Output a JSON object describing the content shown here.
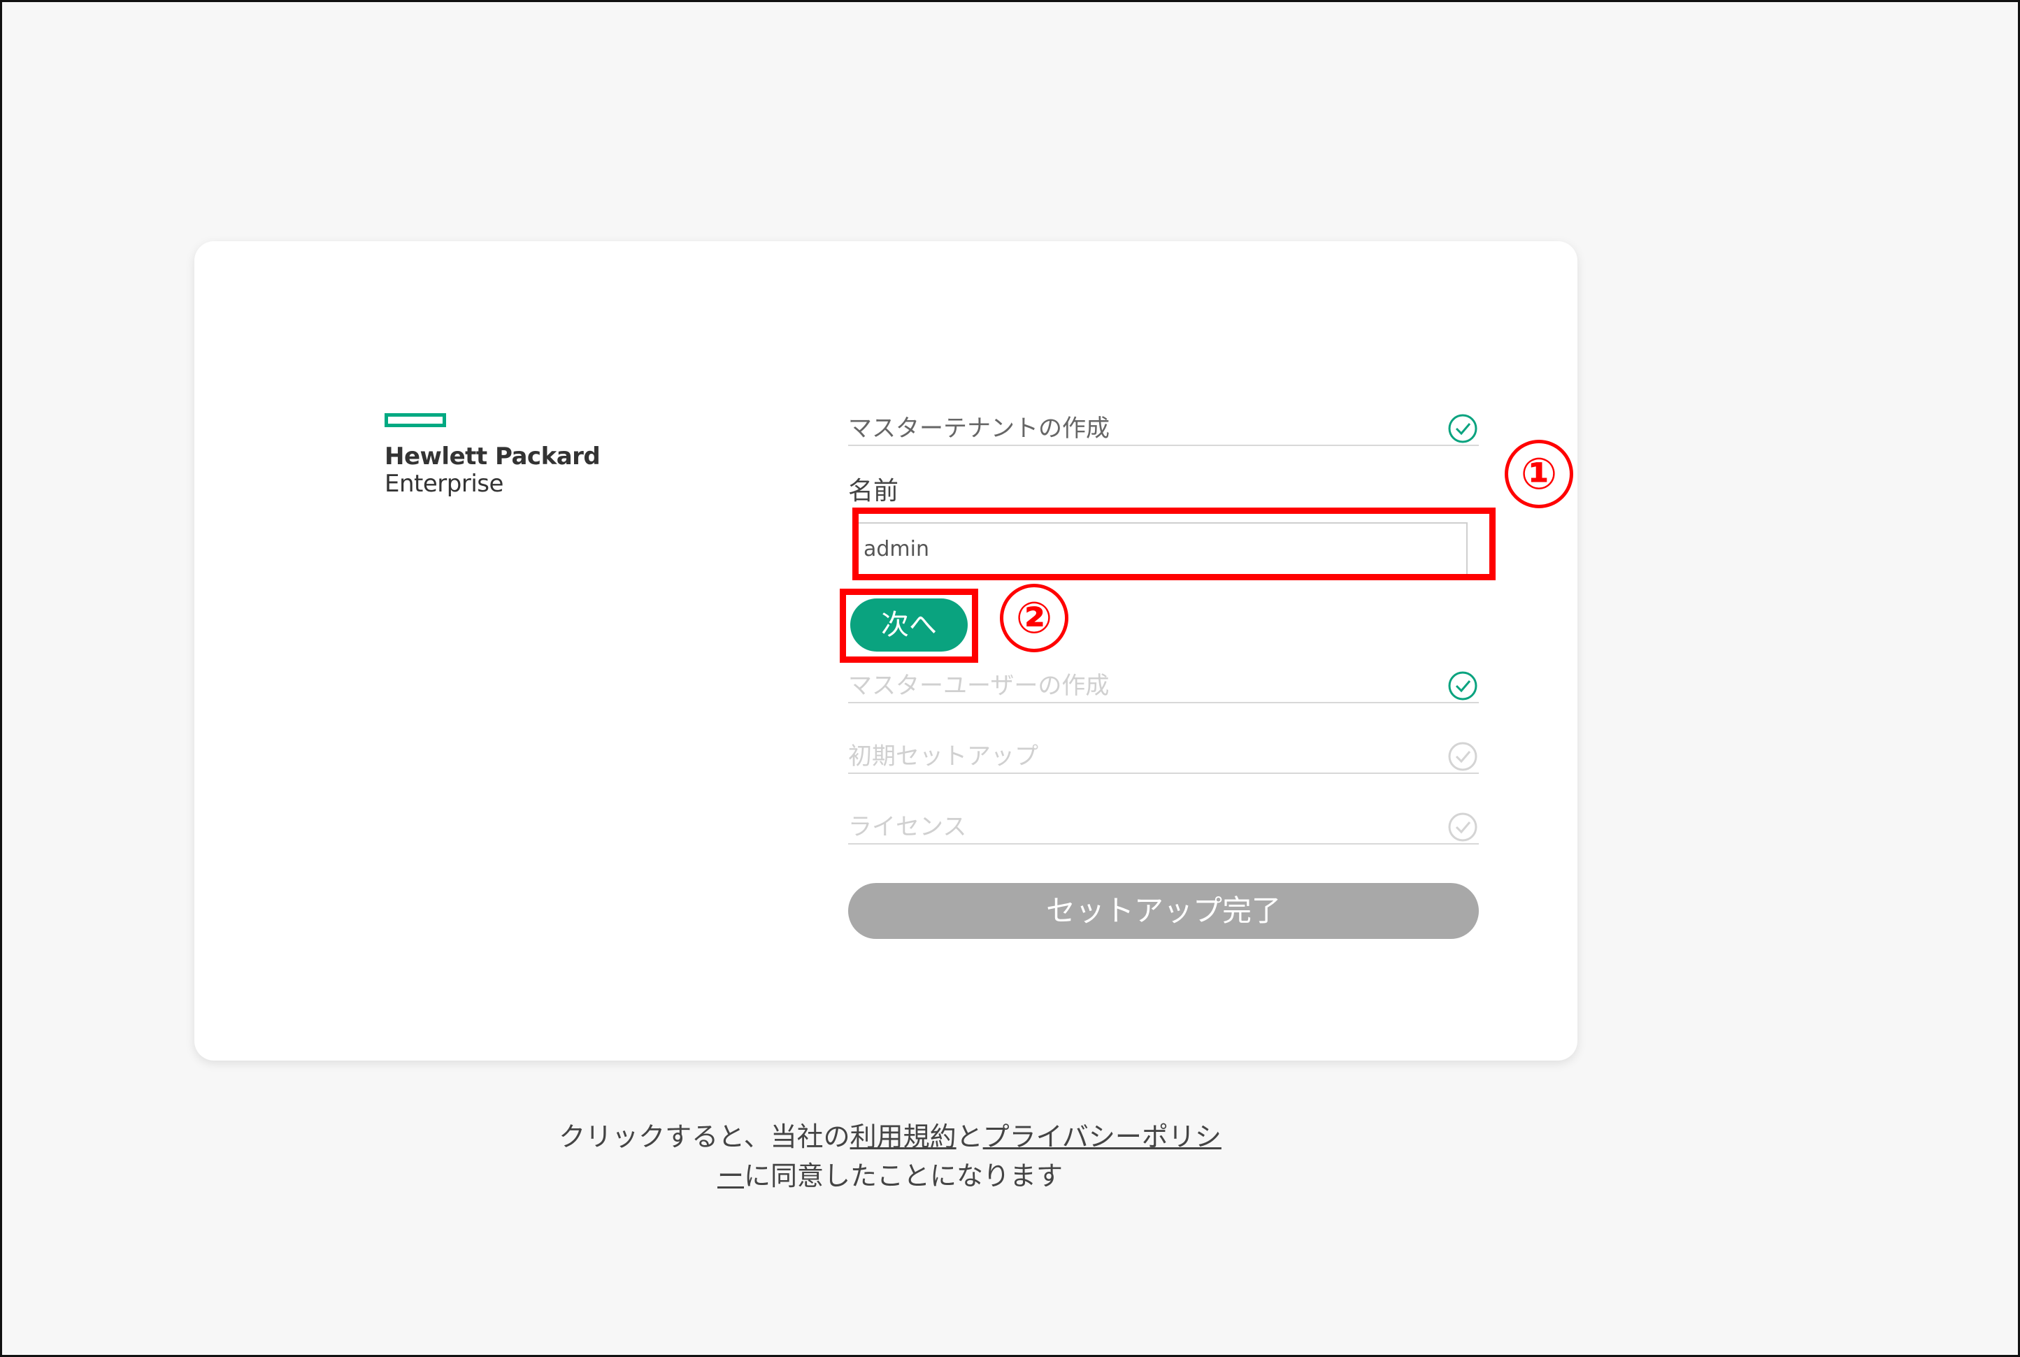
{
  "logo": {
    "line1": "Hewlett Packard",
    "line2": "Enterprise"
  },
  "steps": [
    {
      "label": "マスターテナントの作成",
      "state": "active",
      "icon": "check-circle-icon"
    },
    {
      "label": "マスターユーザーの作成",
      "state": "done",
      "icon": "check-circle-icon"
    },
    {
      "label": "初期セットアップ",
      "state": "pending",
      "icon": "check-circle-icon"
    },
    {
      "label": "ライセンス",
      "state": "pending",
      "icon": "check-circle-icon"
    }
  ],
  "form": {
    "name_label": "名前",
    "name_value": "admin",
    "next_label": "次へ"
  },
  "finish_label": "セットアップ完了",
  "annotations": {
    "one": "①",
    "two": "②"
  },
  "footer": {
    "prefix": "クリックすると、当社の",
    "terms": "利用規約",
    "and": "と",
    "privacy_part1": "プライバシーポリシ",
    "privacy_part2": "ー",
    "suffix": "に同意したことになります"
  },
  "colors": {
    "accent": "#01a982",
    "button_green": "#0aa37f",
    "annotation_red": "#ff0000",
    "disabled_gray": "#a8a8a8"
  }
}
